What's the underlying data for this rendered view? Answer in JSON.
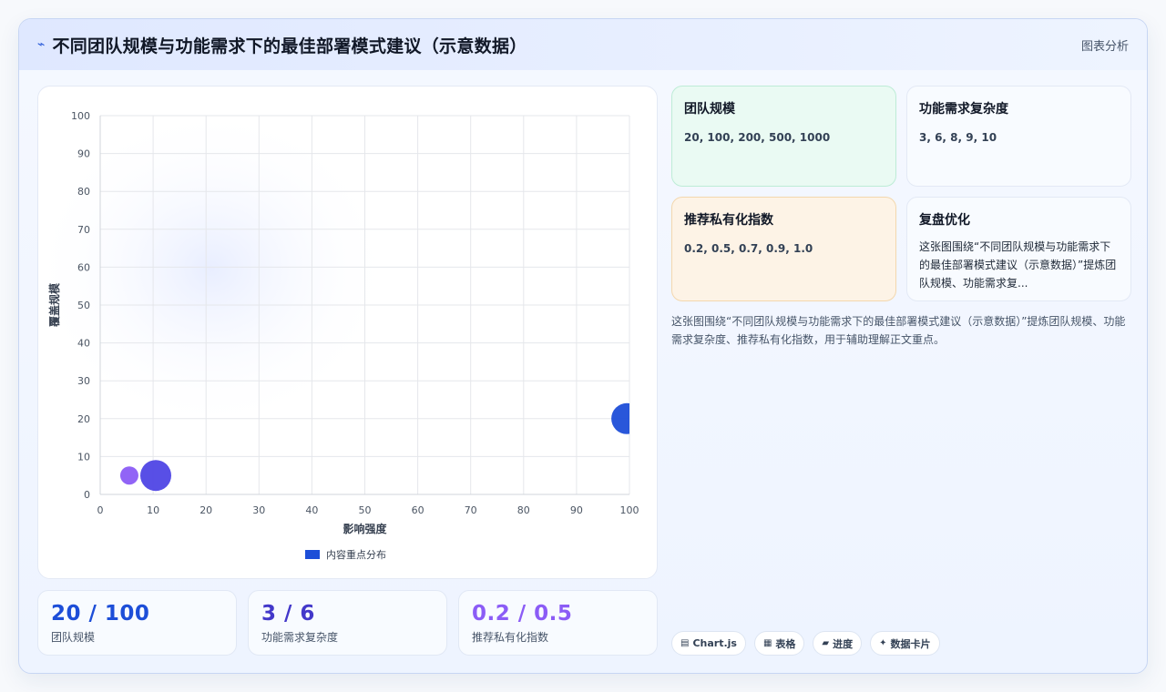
{
  "header": {
    "icon": "lightning-icon",
    "title": "不同团队规模与功能需求下的最佳部署模式建议（示意数据）",
    "tag": "图表分析"
  },
  "chart_data": {
    "type": "scatter",
    "xlabel": "影响强度",
    "ylabel": "覆盖规模",
    "xlim": [
      0,
      100
    ],
    "ylim": [
      0,
      100
    ],
    "xticks": [
      "0",
      "10",
      "20",
      "30",
      "40",
      "50",
      "60",
      "70",
      "80",
      "90",
      "100"
    ],
    "yticks": [
      "0",
      "10",
      "20",
      "30",
      "40",
      "50",
      "60",
      "70",
      "80",
      "90",
      "100"
    ],
    "grid": true,
    "legend_position": "bottom",
    "series": [
      {
        "name": "内容重点分布",
        "color": "#1d4ed8",
        "points": [
          {
            "x": 5.5,
            "y": 5,
            "r": "small",
            "color": "#8b5cf6"
          },
          {
            "x": 10.5,
            "y": 5,
            "r": "medium",
            "color": "#4f46e5"
          },
          {
            "x": 99.5,
            "y": 20,
            "r": "medium",
            "color": "#1d4ed8"
          }
        ]
      }
    ]
  },
  "stats": [
    {
      "value": "20 / 100",
      "label": "团队规模"
    },
    {
      "value": "3 / 6",
      "label": "功能需求复杂度"
    },
    {
      "value": "0.2 / 0.5",
      "label": "推荐私有化指数"
    }
  ],
  "info_cards": [
    {
      "title": "团队规模",
      "value": "20, 100, 200, 500, 1000"
    },
    {
      "title": "功能需求复杂度",
      "value": "3, 6, 8, 9, 10"
    },
    {
      "title": "推荐私有化指数",
      "value": "0.2, 0.5, 0.7, 0.9, 1.0"
    },
    {
      "title": "复盘优化",
      "value": "这张图围绕“不同团队规模与功能需求下的最佳部署模式建议（示意数据）”提炼团队规模、功能需求复..."
    }
  ],
  "summary": "这张图围绕“不同团队规模与功能需求下的最佳部署模式建议（示意数据）”提炼团队规模、功能需求复杂度、推荐私有化指数，用于辅助理解正文重点。",
  "chips": [
    {
      "icon": "chart-icon",
      "label": "Chart.js"
    },
    {
      "icon": "table-icon",
      "label": "表格"
    },
    {
      "icon": "progress-icon",
      "label": "进度"
    },
    {
      "icon": "sparkle-icon",
      "label": "数据卡片"
    }
  ]
}
